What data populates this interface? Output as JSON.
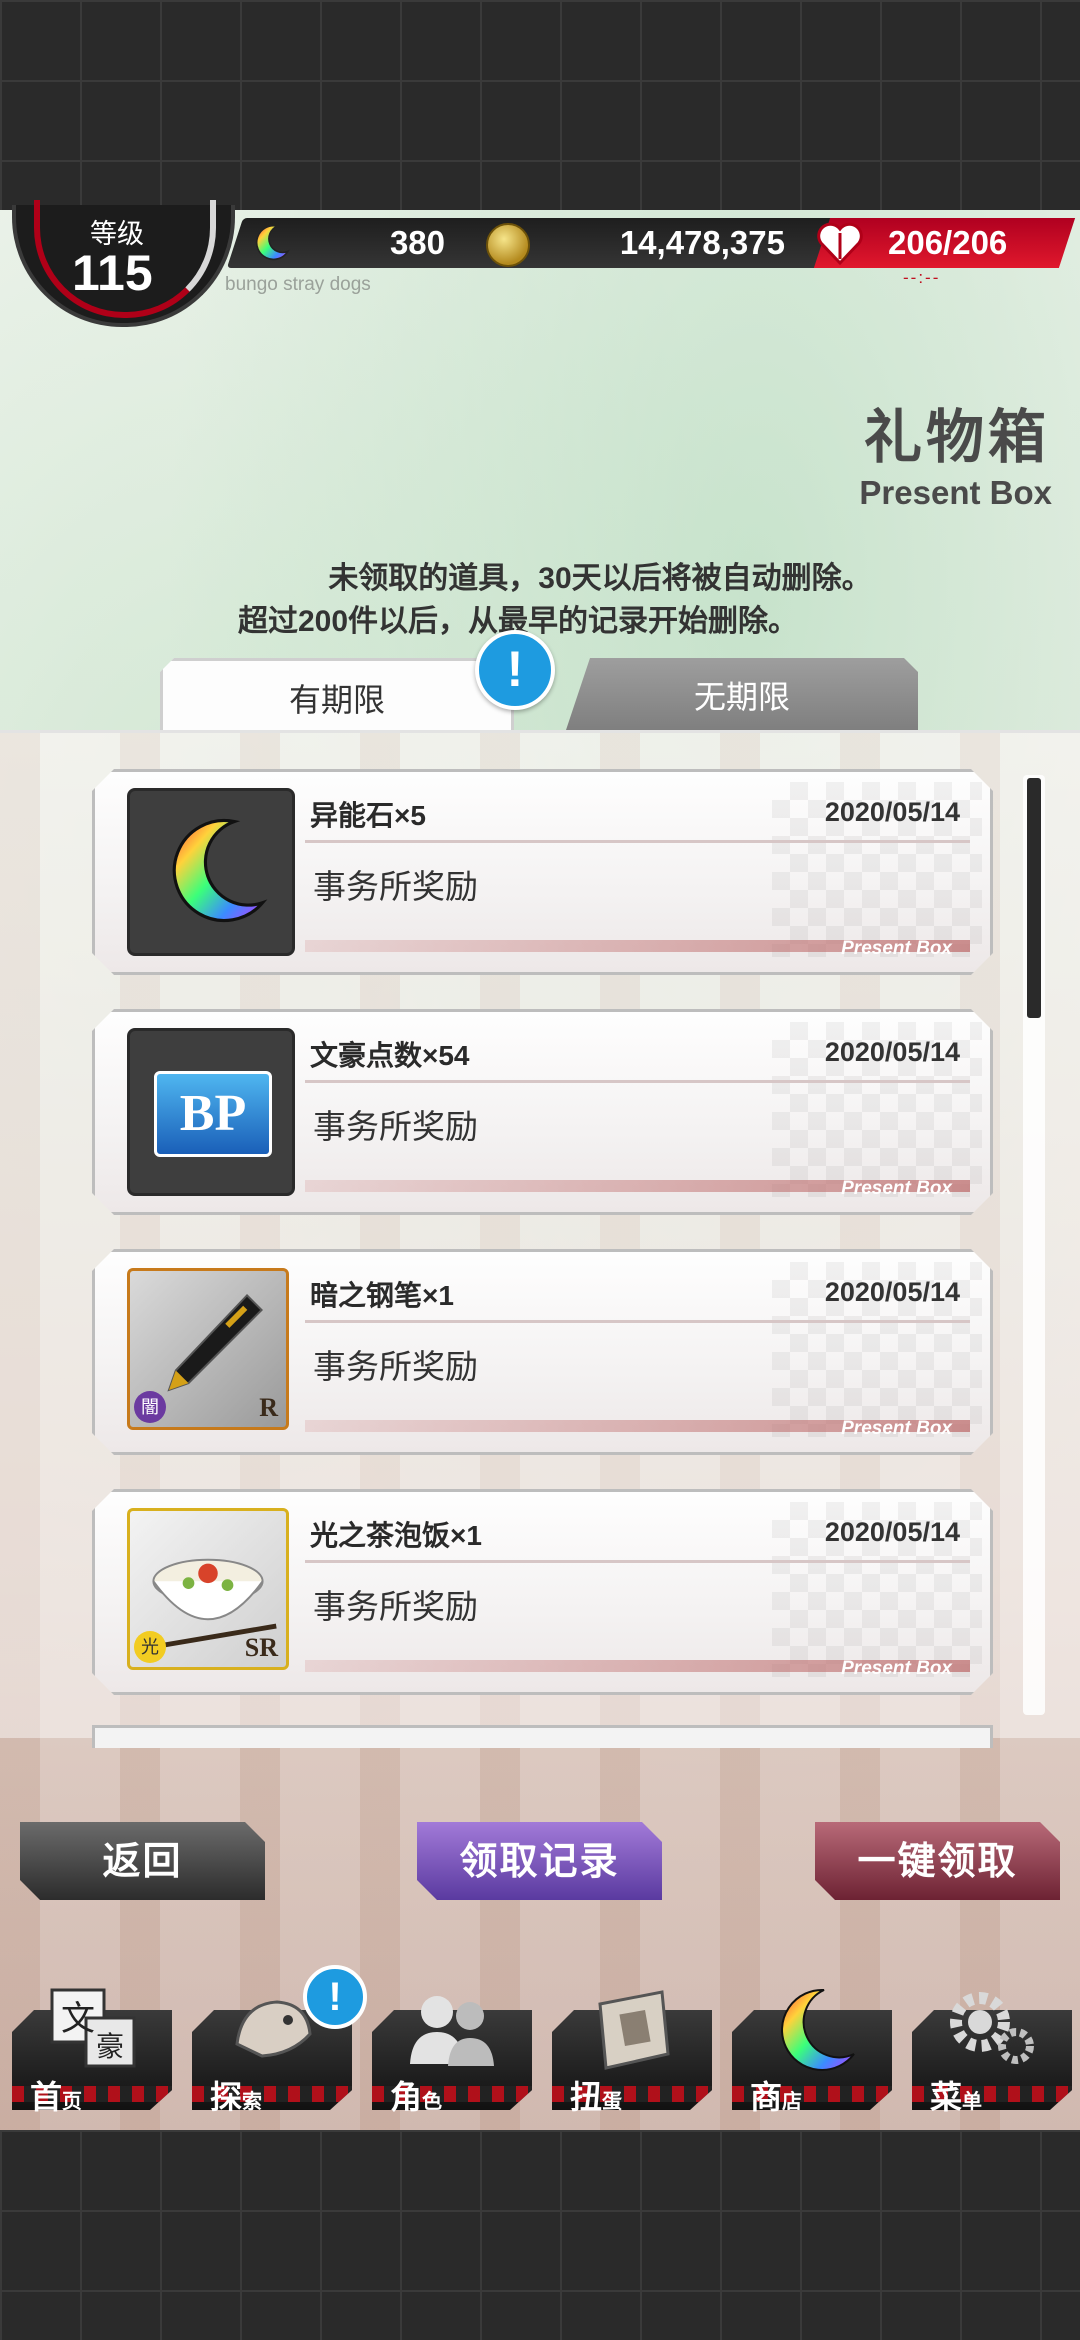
{
  "status_bar": {
    "level_label": "等级",
    "level_value": "115",
    "stone_value": "380",
    "coin_value": "14,478,375",
    "hp_value": "206/206",
    "hp_sub": "--:--",
    "subtitle": "bungo stray dogs"
  },
  "page": {
    "title_cn": "礼物箱",
    "title_en": "Present Box",
    "notice_line1": "未领取的道具，30天以后将被自动删除。",
    "notice_line2": "超过200件以后，从最早的记录开始删除。"
  },
  "tabs": [
    {
      "label": "有期限",
      "active": true
    },
    {
      "label": "无期限",
      "active": false
    }
  ],
  "alert_mark": "!",
  "items": [
    {
      "name": "异能石×5",
      "date": "2020/05/14",
      "source": "事务所奖励",
      "tag": "Present Box",
      "icon": "rainbow-moon-icon"
    },
    {
      "name": "文豪点数×54",
      "date": "2020/05/14",
      "source": "事务所奖励",
      "tag": "Present Box",
      "icon": "bp-book-icon",
      "icon_text": "BP"
    },
    {
      "name": "暗之钢笔×1",
      "date": "2020/05/14",
      "source": "事务所奖励",
      "tag": "Present Box",
      "icon": "fountain-pen-icon",
      "rarity": "R",
      "attr": "闇"
    },
    {
      "name": "光之茶泡饭×1",
      "date": "2020/05/14",
      "source": "事务所奖励",
      "tag": "Present Box",
      "icon": "ochazuke-bowl-icon",
      "rarity": "SR",
      "attr": "光"
    }
  ],
  "buttons": {
    "back": "返回",
    "history": "领取记录",
    "claim_all": "一键领取"
  },
  "nav": [
    {
      "label": "首",
      "small": "页",
      "icon": "bungo-home-icon",
      "icon_text": "文豪"
    },
    {
      "label": "探",
      "small": "索",
      "icon": "explore-icon"
    },
    {
      "label": "角",
      "small": "色",
      "icon": "characters-icon"
    },
    {
      "label": "扭",
      "small": "蛋",
      "icon": "gacha-book-icon"
    },
    {
      "label": "商",
      "small": "店",
      "icon": "shop-moon-icon"
    },
    {
      "label": "菜",
      "small": "单",
      "icon": "menu-gear-icon"
    }
  ],
  "colors": {
    "hp_red": "#d0182c",
    "badge_blue": "#1e9be0",
    "history_purple": "#7a55c0",
    "claim_maroon": "#8a3344"
  }
}
